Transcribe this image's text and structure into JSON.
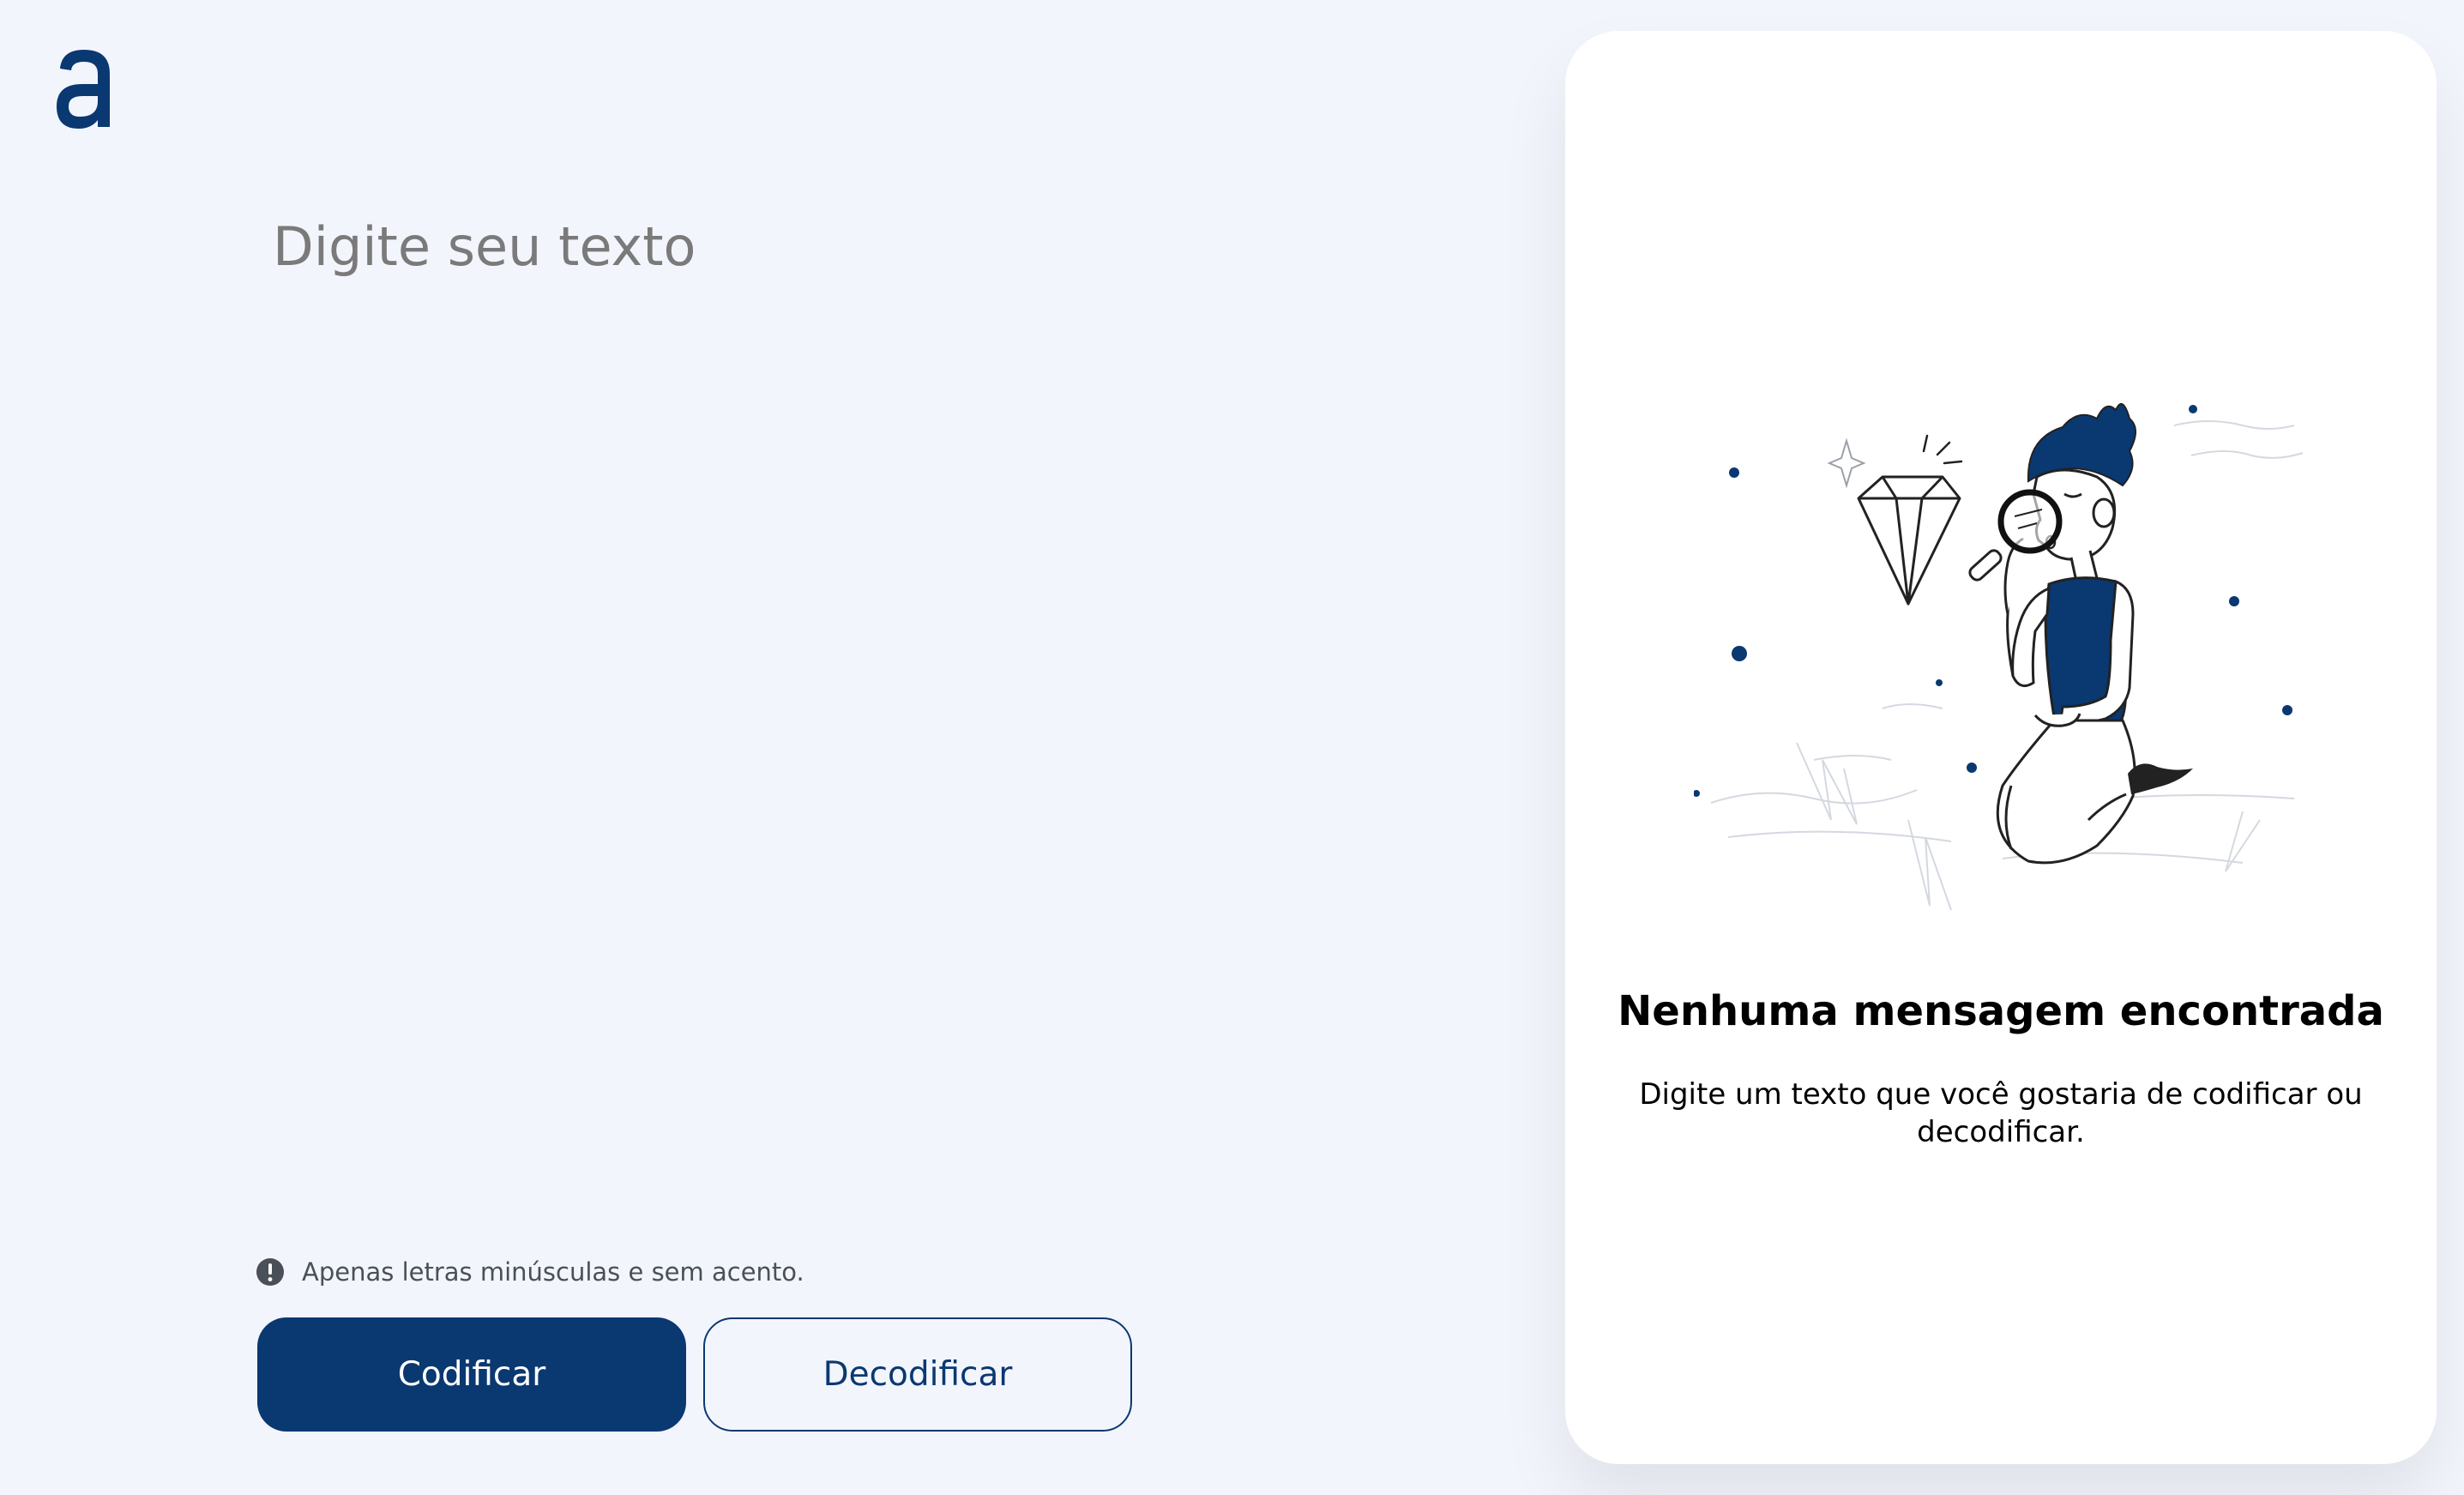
{
  "logo": {
    "icon": "alura-logo-icon",
    "glyph": "a"
  },
  "input": {
    "placeholder": "Digite seu texto",
    "value": ""
  },
  "hint": {
    "icon": "exclamation-circle-icon",
    "text": "Apenas letras minúsculas e sem acento."
  },
  "buttons": {
    "encrypt_label": "Codificar",
    "decrypt_label": "Decodificar"
  },
  "output": {
    "illustration": "person-with-magnifying-glass-and-diamond-illustration",
    "title": "Nenhuma mensagem encontrada",
    "description": "Digite um texto que você gostaria de codificar ou decodificar."
  },
  "colors": {
    "background": "#f3f5fc",
    "primary": "#0a3871",
    "placeholder": "#7a7a7a",
    "panel": "#ffffff",
    "hint_text": "#495057"
  }
}
